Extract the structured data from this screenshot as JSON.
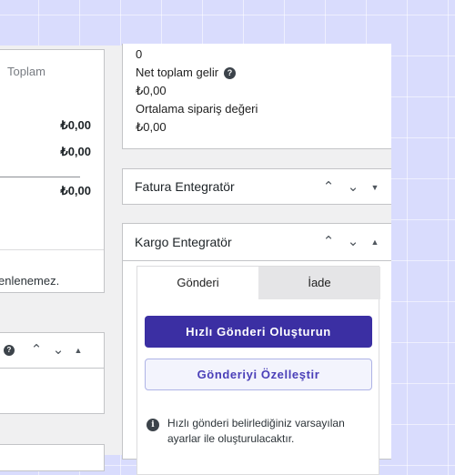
{
  "order_totals": {
    "column_header": "Toplam",
    "rows": [
      "₺0,00",
      "₺0,00"
    ],
    "total": "₺0,00",
    "notice": "enlenemez."
  },
  "stats": {
    "count": "0",
    "net_label": "Net toplam gelir",
    "net_value": "₺0,00",
    "avg_label": "Ortalama sipariş değeri",
    "avg_value": "₺0,00"
  },
  "fatura": {
    "title": "Fatura Entegratör"
  },
  "kargo": {
    "title": "Kargo Entegratör",
    "tabs": [
      {
        "label": "Gönderi",
        "active": true
      },
      {
        "label": "İade",
        "active": false
      }
    ],
    "primary_button": "Hızlı Gönderi Oluşturun",
    "secondary_button": "Gönderiyi Özelleştir",
    "info_text": "Hızlı gönderi belirlediğiniz varsayılan ayarlar ile oluşturulacaktır."
  },
  "colors": {
    "primary": "#3b2fa3",
    "secondary_bg": "#f3f4fd",
    "secondary_text": "#4a3fb8",
    "tab_inactive": "#e5e5e7"
  },
  "icons": [
    "help-icon",
    "chevron-up-icon",
    "chevron-down-icon",
    "triangle-down-icon",
    "triangle-up-icon",
    "info-icon"
  ]
}
